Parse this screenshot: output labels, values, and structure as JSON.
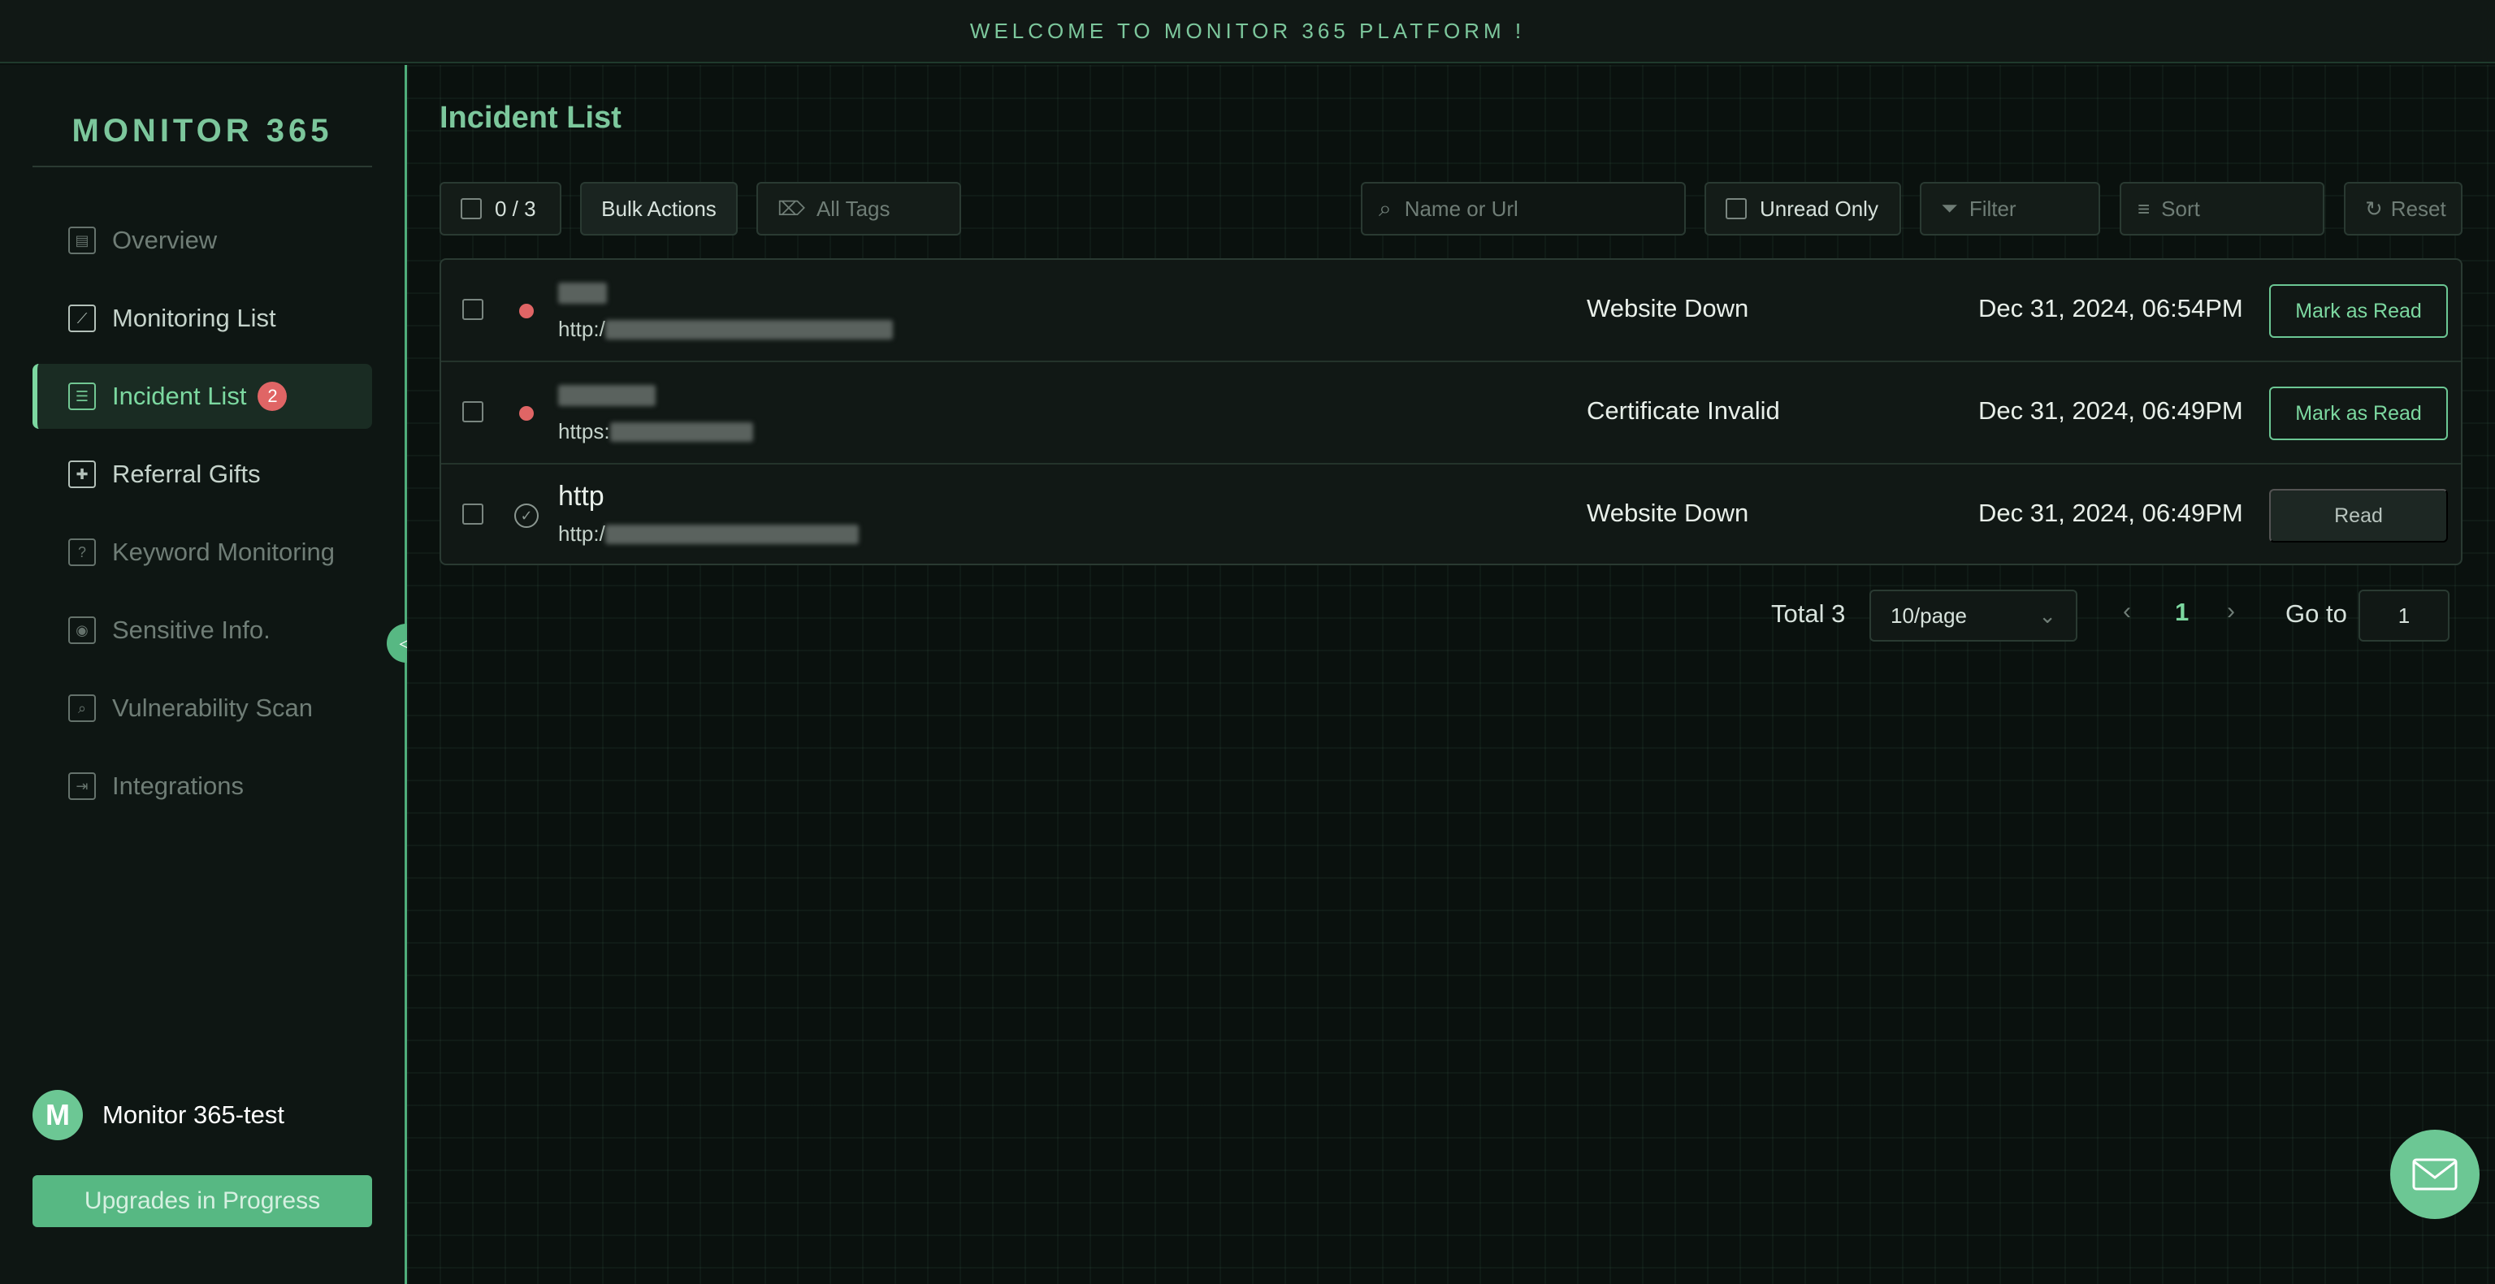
{
  "banner": {
    "text": "WELCOME TO MONITOR 365 PLATFORM !"
  },
  "sidebar": {
    "logo": "MONITOR 365",
    "items": [
      {
        "label": "Overview",
        "icon": "overview-icon"
      },
      {
        "label": "Monitoring List",
        "icon": "chart-icon"
      },
      {
        "label": "Incident List",
        "icon": "list-icon",
        "badge": "2",
        "active": true
      },
      {
        "label": "Referral Gifts",
        "icon": "gift-icon"
      },
      {
        "label": "Keyword Monitoring",
        "icon": "keyword-icon"
      },
      {
        "label": "Sensitive Info.",
        "icon": "sensitive-icon"
      },
      {
        "label": "Vulnerability Scan",
        "icon": "scan-icon"
      },
      {
        "label": "Integrations",
        "icon": "integrations-icon"
      }
    ],
    "user": {
      "avatar_letter": "M",
      "name": "Monitor 365-test"
    },
    "upgrade_label": "Upgrades in Progress"
  },
  "main": {
    "title": "Incident List",
    "toolbar": {
      "selection_count": "0 / 3",
      "bulk_actions": "Bulk Actions",
      "tags_placeholder": "All Tags",
      "search_placeholder": "Name or Url",
      "unread_only": "Unread Only",
      "filter": "Filter",
      "sort": "Sort",
      "reset": "Reset"
    },
    "incidents": [
      {
        "name": "",
        "url_prefix": "http:/",
        "status": "Website Down",
        "time": "Dec 31, 2024, 06:54PM",
        "action": "Mark as Read",
        "unread": true
      },
      {
        "name": "",
        "url_prefix": "https:",
        "status": "Certificate Invalid",
        "time": "Dec 31, 2024, 06:49PM",
        "action": "Mark as Read",
        "unread": true
      },
      {
        "name": "http",
        "url_prefix": "http:/",
        "status": "Website Down",
        "time": "Dec 31, 2024, 06:49PM",
        "action": "Read",
        "unread": false
      }
    ],
    "pagination": {
      "total": "Total 3",
      "page_size": "10/page",
      "current_page": "1",
      "goto_label": "Go to",
      "goto_value": "1"
    }
  },
  "colors": {
    "accent": "#7cc79c",
    "unread_dot": "#e06565",
    "badge": "#e06565"
  }
}
